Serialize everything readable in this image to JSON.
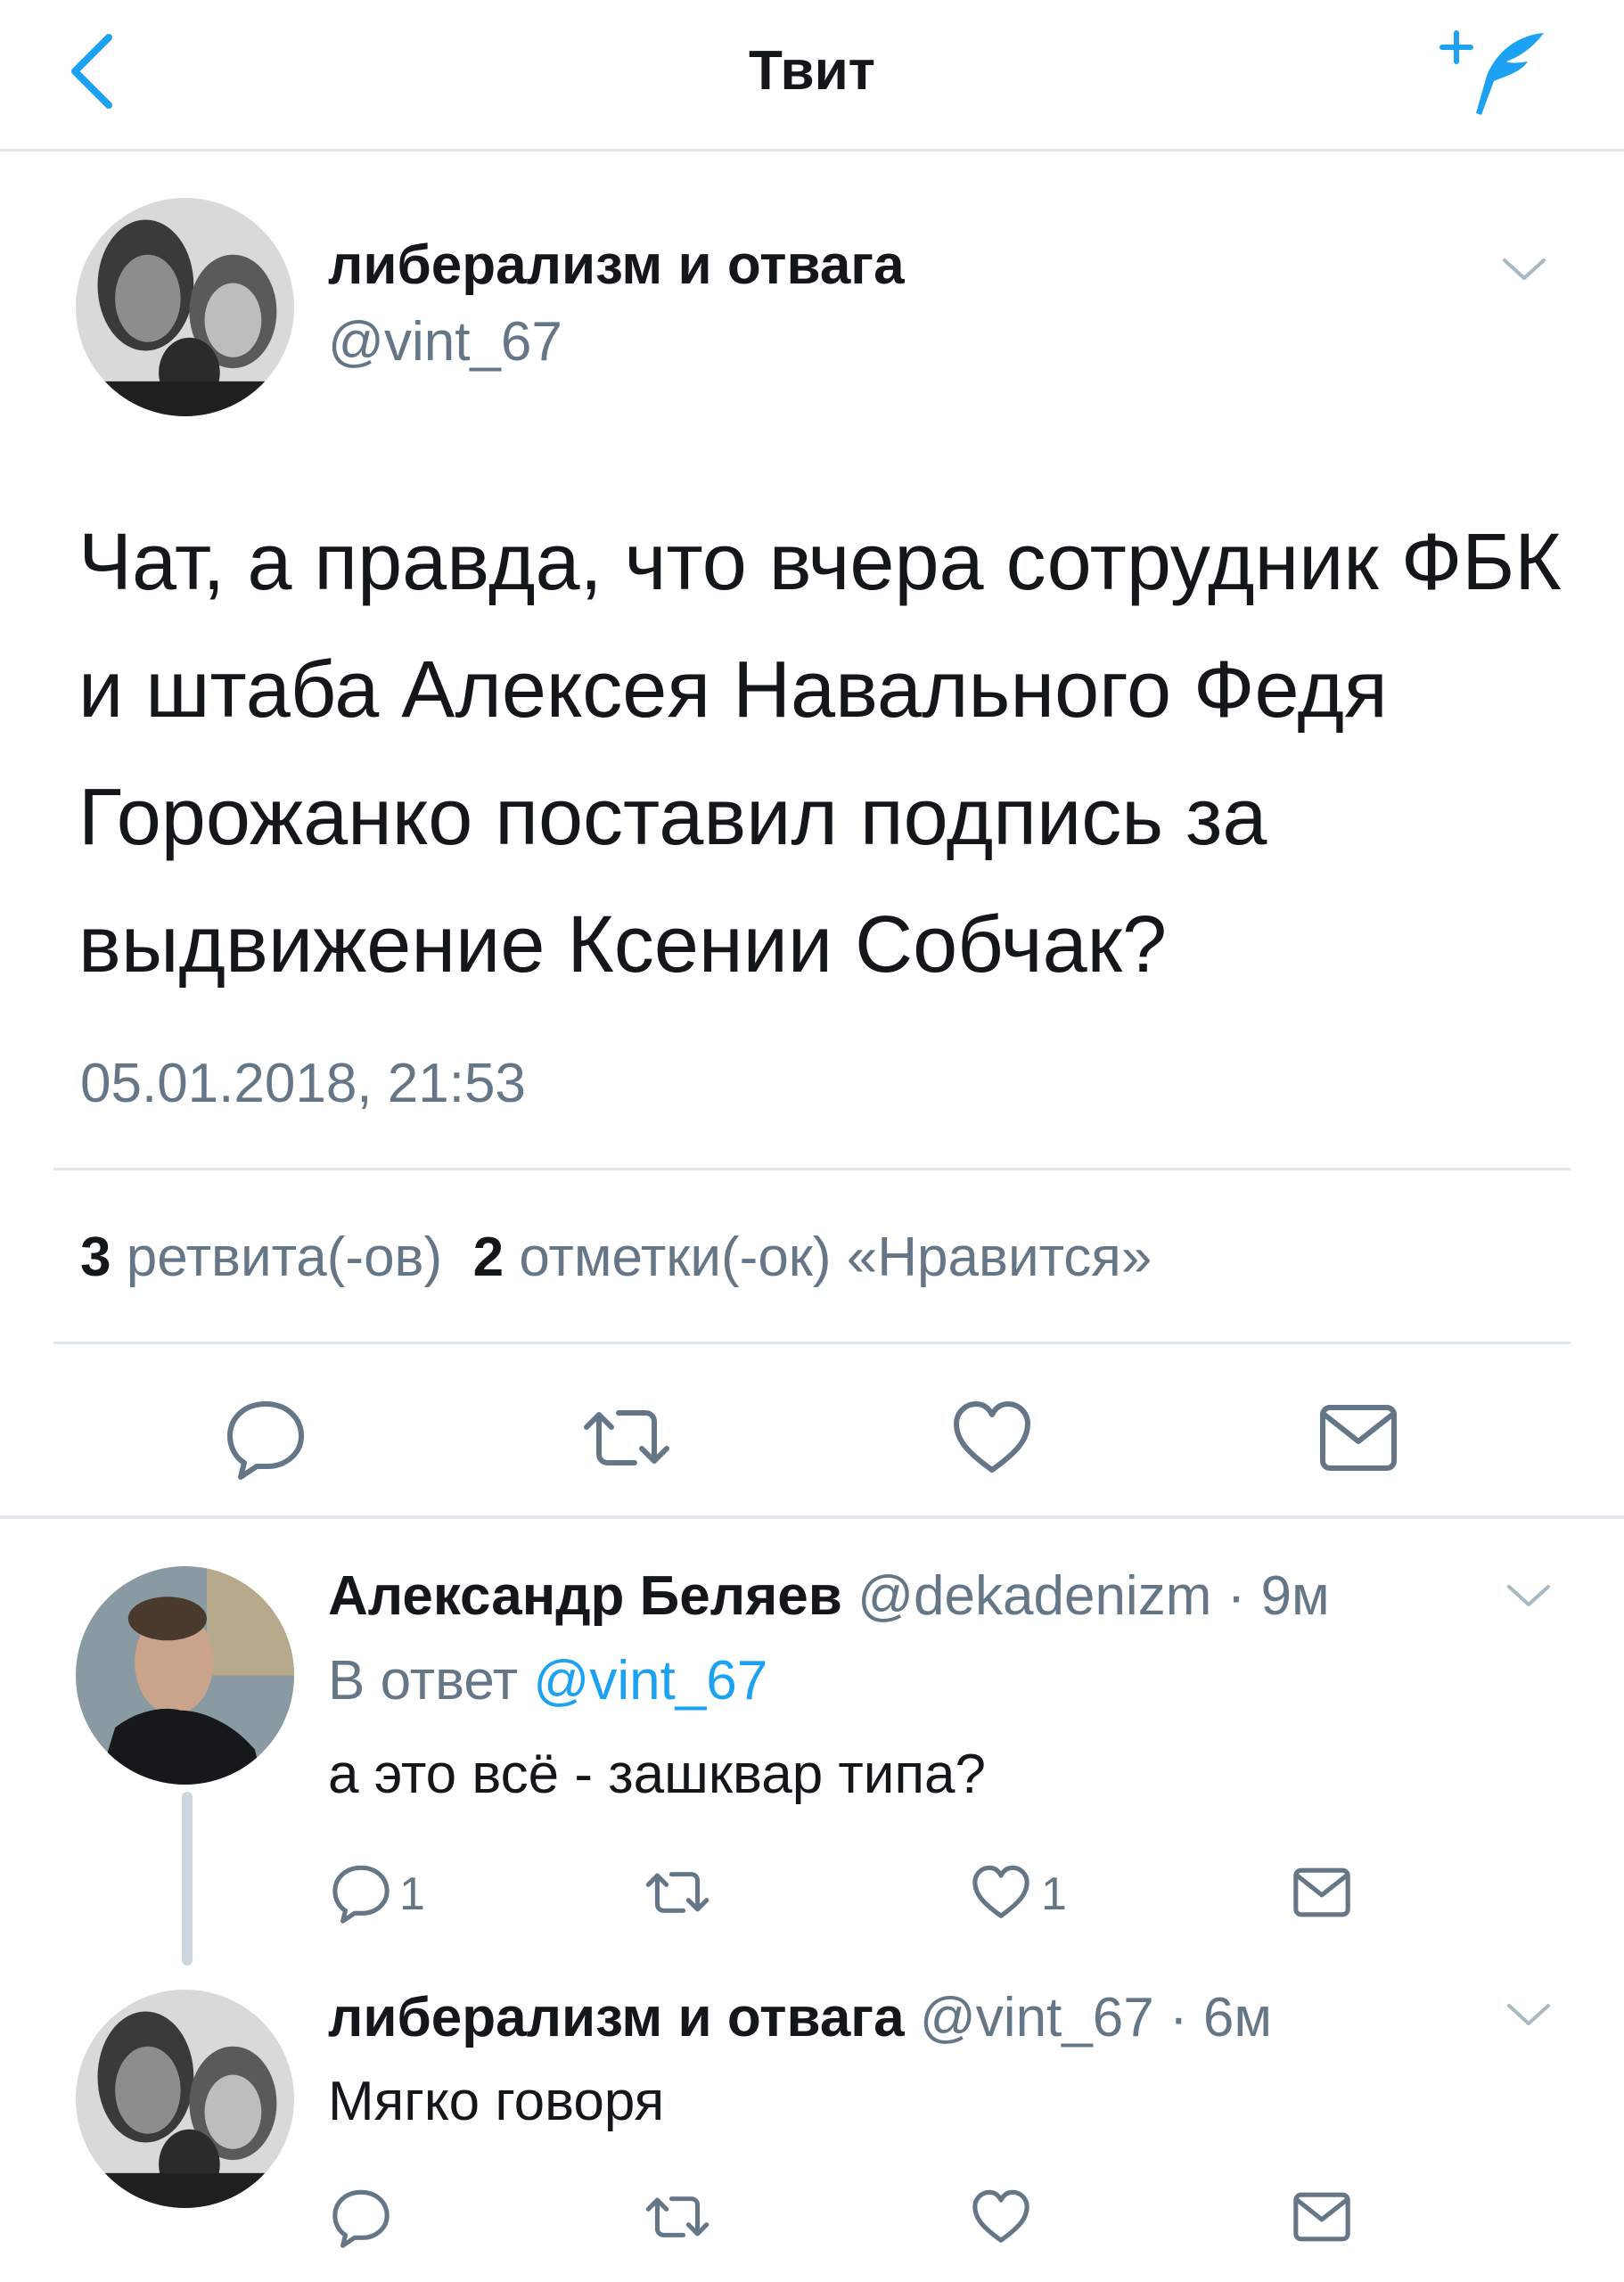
{
  "nav": {
    "title": "Твит",
    "back_icon": "chevron-left-icon",
    "compose_icon": "compose-quill-icon",
    "accent": "#1da1f2"
  },
  "tweet": {
    "author_name": "либерализм и отвага",
    "author_handle": "@vint_67",
    "text": "Чат, а правда, что вчера сотрудник ФБК и штаба Алексея Навального Федя Горожанко поставил подпись за выдвижение Ксении Собчак?",
    "timestamp": "05.01.2018, 21:53",
    "retweet_count": "3",
    "retweet_label": "ретвита(-ов)",
    "like_count": "2",
    "like_label": "отметки(-ок) «Нравится»"
  },
  "replies": [
    {
      "author_name": "Александр Беляев",
      "author_handle": "@dekadenizm",
      "time": "9м",
      "reply_to_label": "В ответ",
      "reply_to_handle": "@vint_67",
      "text": "а это всё - зашквар типа?",
      "reply_count": "1",
      "like_count": "1"
    },
    {
      "author_name": "либерализм и отвага",
      "author_handle": "@vint_67",
      "time": "6м",
      "text": "Мягко говоря"
    }
  ],
  "colors": {
    "text": "#14171a",
    "secondary": "#657786",
    "divider": "#e1e8ed"
  }
}
